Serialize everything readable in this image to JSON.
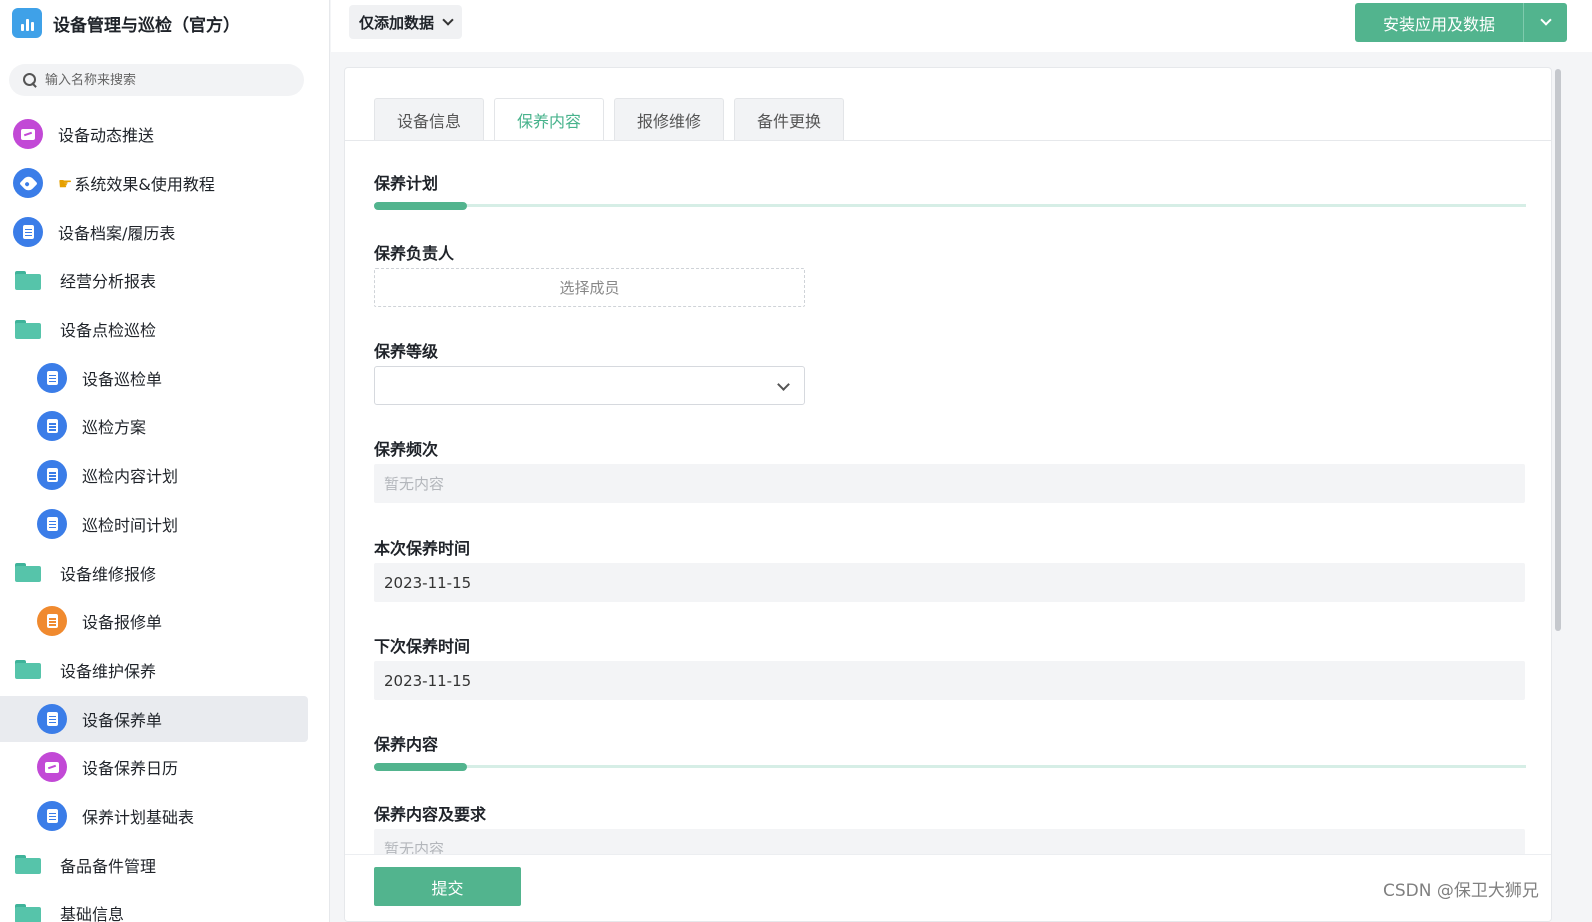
{
  "app": {
    "title": "设备管理与巡检（官方）"
  },
  "search": {
    "placeholder": "输入名称来搜索"
  },
  "sidebar": {
    "items": [
      {
        "label": "设备动态推送"
      },
      {
        "label": "系统效果&使用教程"
      },
      {
        "label": "设备档案/履历表"
      },
      {
        "label": "经营分析报表"
      },
      {
        "label": "设备点检巡检"
      },
      {
        "label": "设备巡检单"
      },
      {
        "label": "巡检方案"
      },
      {
        "label": "巡检内容计划"
      },
      {
        "label": "巡检时间计划"
      },
      {
        "label": "设备维修报修"
      },
      {
        "label": "设备报修单"
      },
      {
        "label": "设备维护保养"
      },
      {
        "label": "设备保养单"
      },
      {
        "label": "设备保养日历"
      },
      {
        "label": "保养计划基础表"
      },
      {
        "label": "备品备件管理"
      },
      {
        "label": "基础信息"
      }
    ]
  },
  "toolbar": {
    "filter_label": "仅添加数据",
    "install_label": "安装应用及数据"
  },
  "tabs": [
    {
      "label": "设备信息"
    },
    {
      "label": "保养内容"
    },
    {
      "label": "报修维修"
    },
    {
      "label": "备件更换"
    }
  ],
  "form": {
    "section_plan": "保养计划",
    "owner_label": "保养负责人",
    "owner_placeholder": "选择成员",
    "level_label": "保养等级",
    "level_value": "",
    "frequency_label": "保养频次",
    "frequency_value": "暂无内容",
    "this_time_label": "本次保养时间",
    "this_time_value": "2023-11-15",
    "next_time_label": "下次保养时间",
    "next_time_value": "2023-11-15",
    "section_content": "保养内容",
    "content_req_label": "保养内容及要求",
    "content_req_value": "暂无内容",
    "submit_label": "提交"
  },
  "watermark": "CSDN @保卫大狮兄",
  "colors": {
    "accent": "#52b48e",
    "tab_active": "#48b38c",
    "icon_blue": "#3b7de8",
    "icon_purple": "#c249d6",
    "icon_orange": "#f08a2f",
    "folder": "#56c4aa"
  }
}
